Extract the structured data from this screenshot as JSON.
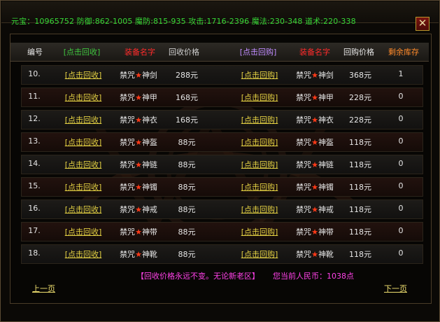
{
  "header_stats": "元宝：10965752 防御:862-1005 魔防:815-935 攻击:1716-2396 魔法:230-348 道术:220-338",
  "close_symbol": "✕",
  "columns": {
    "id": "编号",
    "recycle_action": "[点击回收]",
    "item_name": "装备名字",
    "recycle_price": "回收价格",
    "buyback_action": "[点击回购]",
    "item_name2": "装备名字",
    "buyback_price": "回购价格",
    "stock": "剩余库存"
  },
  "rows": [
    {
      "id": "10.",
      "recycle": "[点击回收]",
      "name_a": "禁咒",
      "name_b": "神剑",
      "price": "288元",
      "buyback": "[点击回购]",
      "name2_a": "禁咒",
      "name2_b": "神剑",
      "buy_price": "368元",
      "stock": "1"
    },
    {
      "id": "11.",
      "recycle": "[点击回收]",
      "name_a": "禁咒",
      "name_b": "神甲",
      "price": "168元",
      "buyback": "[点击回购]",
      "name2_a": "禁咒",
      "name2_b": "神甲",
      "buy_price": "228元",
      "stock": "0"
    },
    {
      "id": "12.",
      "recycle": "[点击回收]",
      "name_a": "禁咒",
      "name_b": "神衣",
      "price": "168元",
      "buyback": "[点击回购]",
      "name2_a": "禁咒",
      "name2_b": "神衣",
      "buy_price": "228元",
      "stock": "0"
    },
    {
      "id": "13.",
      "recycle": "[点击回收]",
      "name_a": "禁咒",
      "name_b": "神盔",
      "price": "88元",
      "buyback": "[点击回购]",
      "name2_a": "禁咒",
      "name2_b": "神盔",
      "buy_price": "118元",
      "stock": "0"
    },
    {
      "id": "14.",
      "recycle": "[点击回收]",
      "name_a": "禁咒",
      "name_b": "神链",
      "price": "88元",
      "buyback": "[点击回购]",
      "name2_a": "禁咒",
      "name2_b": "神链",
      "buy_price": "118元",
      "stock": "0"
    },
    {
      "id": "15.",
      "recycle": "[点击回收]",
      "name_a": "禁咒",
      "name_b": "神镯",
      "price": "88元",
      "buyback": "[点击回购]",
      "name2_a": "禁咒",
      "name2_b": "神镯",
      "buy_price": "118元",
      "stock": "0"
    },
    {
      "id": "16.",
      "recycle": "[点击回收]",
      "name_a": "禁咒",
      "name_b": "神戒",
      "price": "88元",
      "buyback": "[点击回购]",
      "name2_a": "禁咒",
      "name2_b": "神戒",
      "buy_price": "118元",
      "stock": "0"
    },
    {
      "id": "17.",
      "recycle": "[点击回收]",
      "name_a": "禁咒",
      "name_b": "神带",
      "price": "88元",
      "buyback": "[点击回购]",
      "name2_a": "禁咒",
      "name2_b": "神带",
      "buy_price": "118元",
      "stock": "0"
    },
    {
      "id": "18.",
      "recycle": "[点击回收]",
      "name_a": "禁咒",
      "name_b": "神靴",
      "price": "88元",
      "buyback": "[点击回购]",
      "name2_a": "禁咒",
      "name2_b": "神靴",
      "buy_price": "118元",
      "stock": "0"
    }
  ],
  "star_glyph": "★",
  "footer": {
    "notice": "【回收价格永远不变。无论新老区】",
    "balance_label": "您当前人民币：",
    "balance_value": "1038点",
    "prev": "上一页",
    "next": "下一页"
  },
  "colors": {
    "stats": "#36d636",
    "link": "#e3d043",
    "item_name": "#ff2b2b",
    "buyback": "#c08cff",
    "notice": "#ff41e8"
  }
}
